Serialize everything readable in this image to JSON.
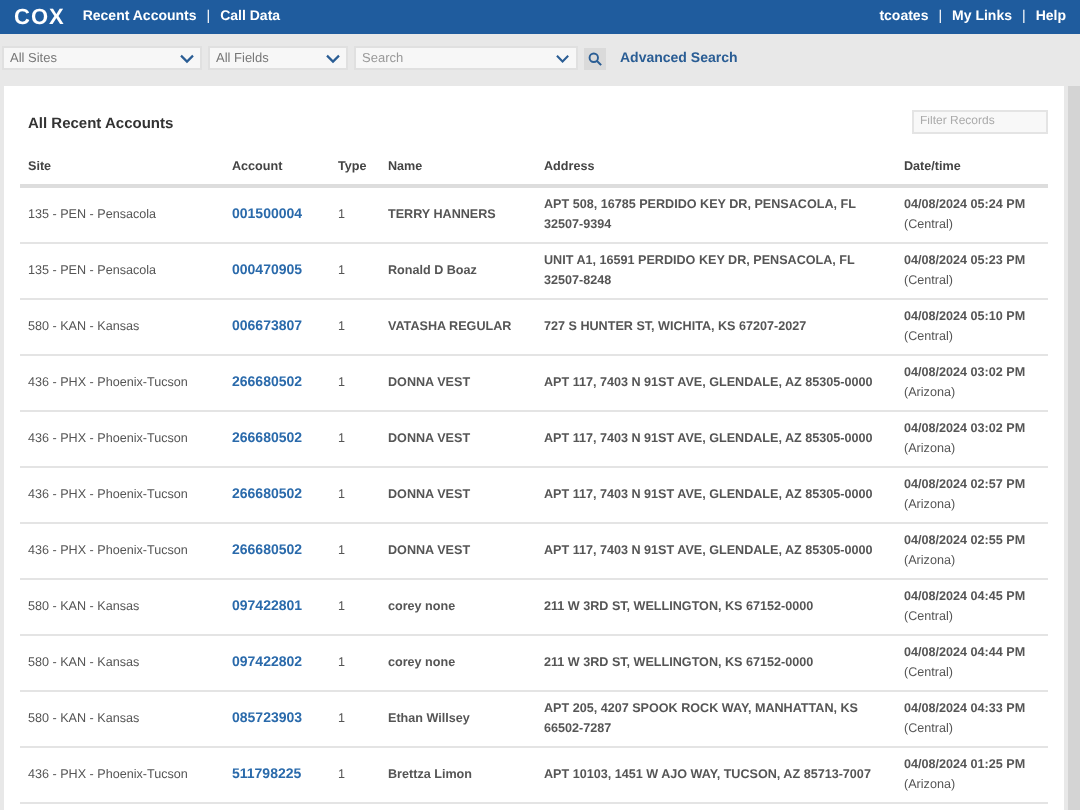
{
  "top_bar": {
    "logo": "COX",
    "separator": "|",
    "nav": [
      {
        "label": "Recent Accounts"
      },
      {
        "label": "Call Data"
      }
    ],
    "user_links": [
      {
        "label": "tcoates"
      },
      {
        "label": "My Links"
      },
      {
        "label": "Help"
      }
    ]
  },
  "search_bar": {
    "site_select": "All Sites",
    "field_select": "All Fields",
    "search": {
      "placeholder": "Search"
    },
    "advanced_search": "Advanced Search"
  },
  "panel": {
    "title": "All Recent Accounts",
    "filter": {
      "placeholder": "Filter Records"
    },
    "table": {
      "columns": [
        "Site",
        "Account",
        "Type",
        "Name",
        "Address",
        "Date/time"
      ],
      "rows": [
        {
          "site": "135 - PEN - Pensacola",
          "account": "001500004",
          "type": "1",
          "name": "TERRY HANNERS",
          "address": "APT 508, 16785 PERDIDO KEY DR, PENSACOLA, FL 32507-9394",
          "datetime": "04/08/2024 05:24 PM",
          "zone": "(Central)"
        },
        {
          "site": "135 - PEN - Pensacola",
          "account": "000470905",
          "type": "1",
          "name": "Ronald D Boaz",
          "address": "UNIT A1, 16591 PERDIDO KEY DR, PENSACOLA, FL 32507-8248",
          "datetime": "04/08/2024 05:23 PM",
          "zone": "(Central)"
        },
        {
          "site": "580 - KAN - Kansas",
          "account": "006673807",
          "type": "1",
          "name": "VATASHA REGULAR",
          "address": "727 S HUNTER ST, WICHITA, KS 67207-2027",
          "datetime": "04/08/2024 05:10 PM",
          "zone": "(Central)"
        },
        {
          "site": "436 - PHX - Phoenix-Tucson",
          "account": "266680502",
          "type": "1",
          "name": "DONNA VEST",
          "address": "APT 117, 7403 N 91ST AVE, GLENDALE, AZ 85305-0000",
          "datetime": "04/08/2024 03:02 PM",
          "zone": "(Arizona)"
        },
        {
          "site": "436 - PHX - Phoenix-Tucson",
          "account": "266680502",
          "type": "1",
          "name": "DONNA VEST",
          "address": "APT 117, 7403 N 91ST AVE, GLENDALE, AZ 85305-0000",
          "datetime": "04/08/2024 03:02 PM",
          "zone": "(Arizona)"
        },
        {
          "site": "436 - PHX - Phoenix-Tucson",
          "account": "266680502",
          "type": "1",
          "name": "DONNA VEST",
          "address": "APT 117, 7403 N 91ST AVE, GLENDALE, AZ 85305-0000",
          "datetime": "04/08/2024 02:57 PM",
          "zone": "(Arizona)"
        },
        {
          "site": "436 - PHX - Phoenix-Tucson",
          "account": "266680502",
          "type": "1",
          "name": "DONNA VEST",
          "address": "APT 117, 7403 N 91ST AVE, GLENDALE, AZ 85305-0000",
          "datetime": "04/08/2024 02:55 PM",
          "zone": "(Arizona)"
        },
        {
          "site": "580 - KAN - Kansas",
          "account": "097422801",
          "type": "1",
          "name": "corey none",
          "address": "211 W 3RD ST, WELLINGTON, KS 67152-0000",
          "datetime": "04/08/2024 04:45 PM",
          "zone": "(Central)"
        },
        {
          "site": "580 - KAN - Kansas",
          "account": "097422802",
          "type": "1",
          "name": "corey none",
          "address": "211 W 3RD ST, WELLINGTON, KS 67152-0000",
          "datetime": "04/08/2024 04:44 PM",
          "zone": "(Central)"
        },
        {
          "site": "580 - KAN - Kansas",
          "account": "085723903",
          "type": "1",
          "name": "Ethan Willsey",
          "address": "APT 205, 4207 SPOOK ROCK WAY, MANHATTAN, KS 66502-7287",
          "datetime": "04/08/2024 04:33 PM",
          "zone": "(Central)"
        },
        {
          "site": "436 - PHX - Phoenix-Tucson",
          "account": "511798225",
          "type": "1",
          "name": "Brettza Limon",
          "address": "APT 10103, 1451 W AJO WAY, TUCSON, AZ 85713-7007",
          "datetime": "04/08/2024 01:25 PM",
          "zone": "(Arizona)"
        }
      ]
    }
  }
}
